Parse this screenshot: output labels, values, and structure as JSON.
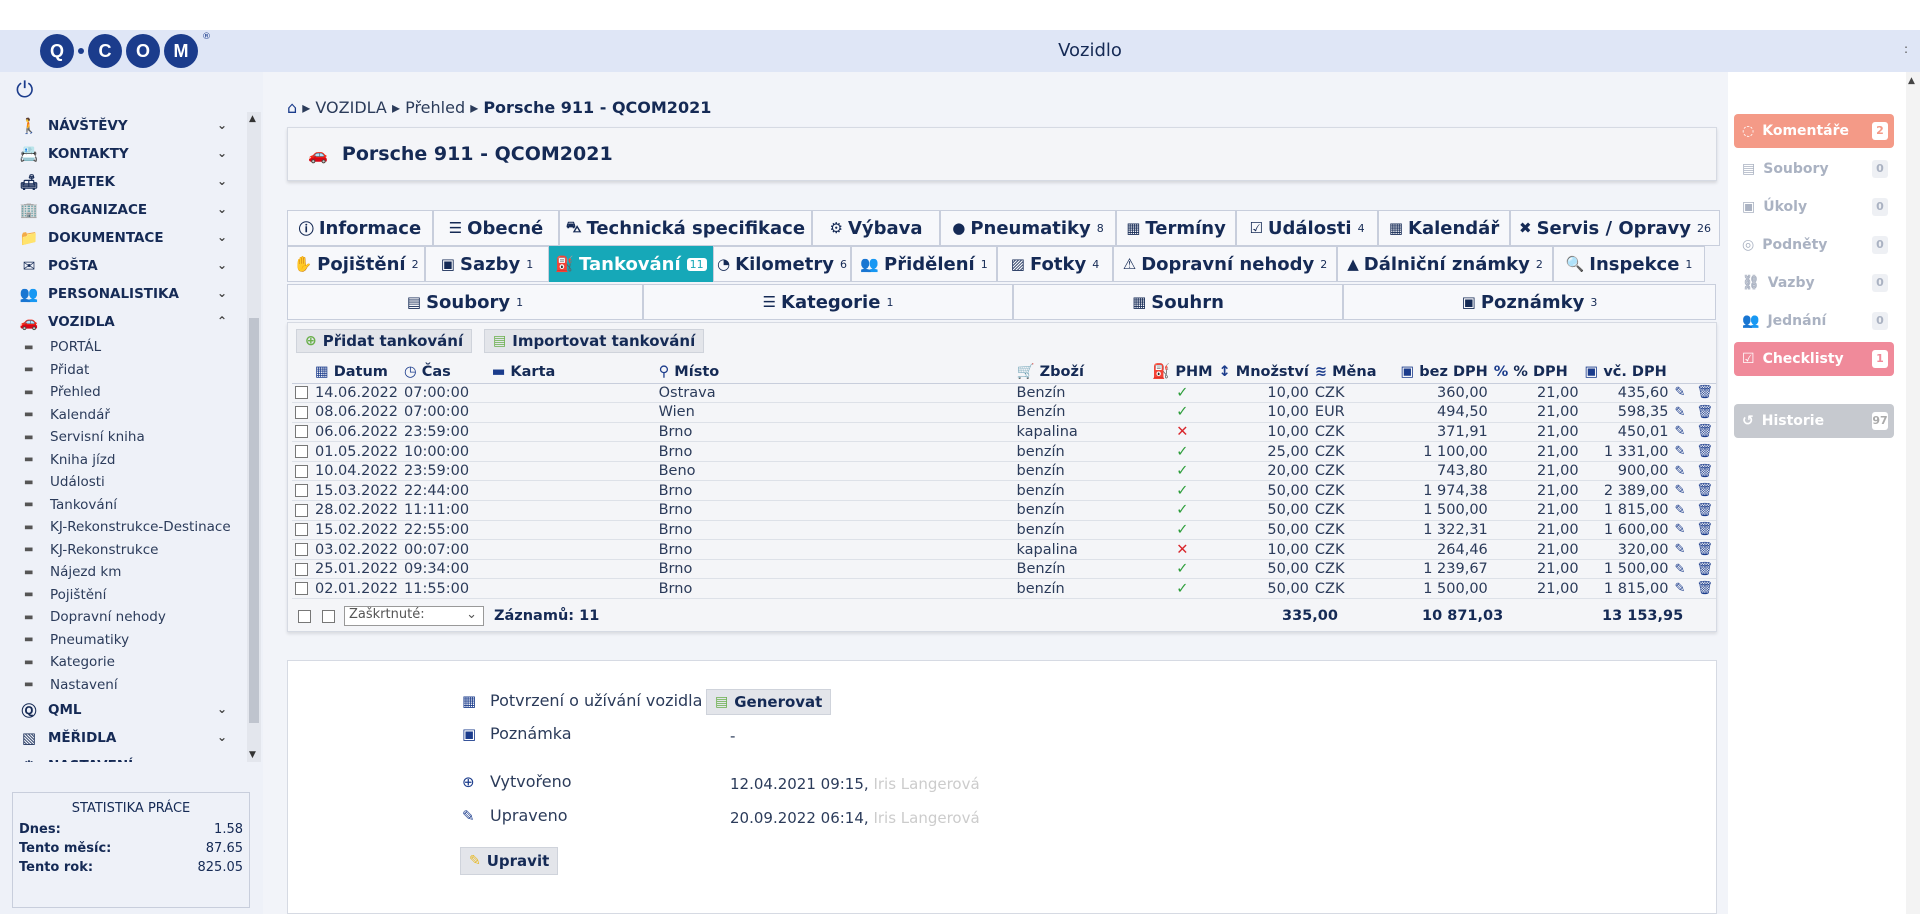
{
  "app": {
    "logo_text": "Q·COM",
    "header_title": "Vozidlo",
    "header_dots": ":"
  },
  "sidebar": {
    "main_items": [
      {
        "label": "NÁVŠTĚVY",
        "icon": "walker-icon"
      },
      {
        "label": "KONTAKTY",
        "icon": "contacts-icon"
      },
      {
        "label": "MAJETEK",
        "icon": "sofa-icon"
      },
      {
        "label": "ORGANIZACE",
        "icon": "organization-icon"
      },
      {
        "label": "DOKUMENTACE",
        "icon": "documents-icon"
      },
      {
        "label": "POŠTA",
        "icon": "mail-icon"
      },
      {
        "label": "PERSONALISTIKA",
        "icon": "personnel-icon"
      }
    ],
    "vozidla_label": "VOZIDLA",
    "vozidla_sub": [
      "PORTÁL",
      "Přidat",
      "Přehled",
      "Kalendář",
      "Servisní kniha",
      "Kniha jízd",
      "Události",
      "Tankování",
      "KJ-Rekonstrukce-Destinace",
      "KJ-Rekonstrukce",
      "Nájezd km",
      "Pojištění",
      "Dopravní nehody",
      "Pneumatiky",
      "Kategorie",
      "Nastavení"
    ],
    "bottom_items": [
      {
        "label": "QML"
      },
      {
        "label": "MĚŘIDLA"
      },
      {
        "label": "NASTAVENÍ"
      }
    ],
    "stats": {
      "title": "STATISTIKA PRÁCE",
      "today_label": "Dnes:",
      "today": "1.58",
      "month_label": "Tento měsíc:",
      "month": "87.65",
      "year_label": "Tento rok:",
      "year": "825.05"
    }
  },
  "breadcrumb": {
    "level1": "VOZIDLA",
    "level2": "Přehled",
    "current": "Porsche 911 - QCOM2021"
  },
  "vehicle_title": "Porsche 911 - QCOM2021",
  "tabs_row1": [
    {
      "label": "Informace",
      "count": ""
    },
    {
      "label": "Obecné",
      "count": ""
    },
    {
      "label": "Technická specifikace",
      "count": ""
    },
    {
      "label": "Výbava",
      "count": ""
    },
    {
      "label": "Pneumatiky",
      "count": "8"
    },
    {
      "label": "Termíny",
      "count": ""
    },
    {
      "label": "Události",
      "count": "4"
    },
    {
      "label": "Kalendář",
      "count": ""
    },
    {
      "label": "Servis / Opravy",
      "count": "26"
    }
  ],
  "tabs_row2": [
    {
      "label": "Pojištění",
      "count": "2"
    },
    {
      "label": "Sazby",
      "count": "1"
    },
    {
      "label": "Tankování",
      "count": "11"
    },
    {
      "label": "Kilometry",
      "count": "6"
    },
    {
      "label": "Přidělení",
      "count": "1"
    },
    {
      "label": "Fotky",
      "count": "4"
    },
    {
      "label": "Dopravní nehody",
      "count": "2"
    },
    {
      "label": "Dálniční známky",
      "count": "2"
    },
    {
      "label": "Inspekce",
      "count": "1"
    }
  ],
  "tabs_row3": [
    {
      "label": "Soubory",
      "count": "1"
    },
    {
      "label": "Kategorie",
      "count": "1"
    },
    {
      "label": "Souhrn",
      "count": ""
    },
    {
      "label": "Poznámky",
      "count": "3"
    }
  ],
  "actions": {
    "add": "Přidat tankování",
    "import": "Importovat tankování"
  },
  "table": {
    "headers": [
      "Datum",
      "Čas",
      "Karta",
      "Místo",
      "Zboží",
      "PHM",
      "Množství",
      "Měna",
      "bez DPH",
      "% DPH",
      "vč. DPH"
    ],
    "rows": [
      [
        "14.06.2022",
        "07:00:00",
        "",
        "Ostrava",
        "Benzín",
        "ok",
        "10,00",
        "CZK",
        "360,00",
        "21,00",
        "435,60"
      ],
      [
        "08.06.2022",
        "07:00:00",
        "",
        "Wien",
        "Benzín",
        "ok",
        "10,00",
        "EUR",
        "494,50",
        "21,00",
        "598,35"
      ],
      [
        "06.06.2022",
        "23:59:00",
        "",
        "Brno",
        "kapalina",
        "no",
        "10,00",
        "CZK",
        "371,91",
        "21,00",
        "450,01"
      ],
      [
        "01.05.2022",
        "10:00:00",
        "",
        "Brno",
        "benzín",
        "ok",
        "25,00",
        "CZK",
        "1 100,00",
        "21,00",
        "1 331,00"
      ],
      [
        "10.04.2022",
        "23:59:00",
        "",
        "Beno",
        "benzín",
        "ok",
        "20,00",
        "CZK",
        "743,80",
        "21,00",
        "900,00"
      ],
      [
        "15.03.2022",
        "22:44:00",
        "",
        "Brno",
        "benzín",
        "ok",
        "50,00",
        "CZK",
        "1 974,38",
        "21,00",
        "2 389,00"
      ],
      [
        "28.02.2022",
        "11:11:00",
        "",
        "Brno",
        "benzín",
        "ok",
        "50,00",
        "CZK",
        "1 500,00",
        "21,00",
        "1 815,00"
      ],
      [
        "15.02.2022",
        "22:55:00",
        "",
        "Brno",
        "benzín",
        "ok",
        "50,00",
        "CZK",
        "1 322,31",
        "21,00",
        "1 600,00"
      ],
      [
        "03.02.2022",
        "00:07:00",
        "",
        "Brno",
        "kapalina",
        "no",
        "10,00",
        "CZK",
        "264,46",
        "21,00",
        "320,00"
      ],
      [
        "25.01.2022",
        "09:34:00",
        "",
        "Brno",
        "Benzín",
        "ok",
        "50,00",
        "CZK",
        "1 239,67",
        "21,00",
        "1 500,00"
      ],
      [
        "02.01.2022",
        "11:55:00",
        "",
        "Brno",
        "benzín",
        "ok",
        "50,00",
        "CZK",
        "1 500,00",
        "21,00",
        "1 815,00"
      ]
    ],
    "footer": {
      "select_value": "Zaškrtnuté:",
      "records": "Záznamů: 11",
      "sum_qty": "335,00",
      "sum_net": "10 871,03",
      "sum_gross": "13 153,95"
    }
  },
  "info": {
    "confirm_label": "Potvrzení o užívání vozidla",
    "generate_label": "Generovat",
    "note_label": "Poznámka",
    "note_value": "-",
    "created_label": "Vytvořeno",
    "created_value": "12.04.2021 09:15,",
    "created_by": "Iris Langerová",
    "updated_label": "Upraveno",
    "updated_value": "20.09.2022 06:14,",
    "updated_by": "Iris Langerová",
    "edit_label": "Upravit"
  },
  "right_panel": [
    {
      "label": "Komentáře",
      "count": "2",
      "style": "salmon"
    },
    {
      "label": "Soubory",
      "count": "0",
      "style": "dim"
    },
    {
      "label": "Úkoly",
      "count": "0",
      "style": "dim"
    },
    {
      "label": "Podněty",
      "count": "0",
      "style": "dim"
    },
    {
      "label": "Vazby",
      "count": "0",
      "style": "dim"
    },
    {
      "label": "Jednání",
      "count": "0",
      "style": "dim"
    },
    {
      "label": "Checklisty",
      "count": "1",
      "style": "pink"
    },
    {
      "label": "Historie",
      "count": "97",
      "style": "grey"
    }
  ],
  "colors": {
    "accent": "#16a8b8",
    "brand": "#1b3c8c",
    "salmon": "#f49a87",
    "pink": "#f08a9a",
    "grey": "#c6c9cf",
    "ok": "#2e9e3c",
    "no": "#d9262c"
  }
}
